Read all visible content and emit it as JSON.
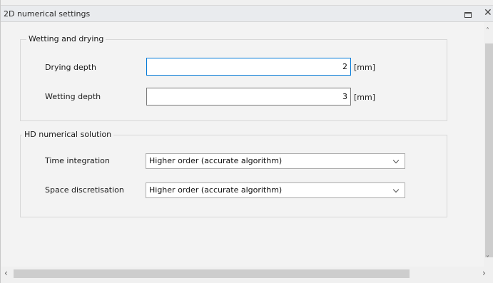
{
  "window": {
    "title": "2D numerical settings"
  },
  "wetting_drying": {
    "legend": "Wetting and drying",
    "drying_depth": {
      "label": "Drying depth",
      "value": "2",
      "unit": "[mm]"
    },
    "wetting_depth": {
      "label": "Wetting depth",
      "value": "3",
      "unit": "[mm]"
    }
  },
  "hd_solution": {
    "legend": "HD numerical solution",
    "time_integration": {
      "label": "Time integration",
      "selected": "Higher order (accurate algorithm)"
    },
    "space_discretisation": {
      "label": "Space discretisation",
      "selected": "Higher order (accurate algorithm)"
    }
  },
  "icons": {
    "restore": "restore-icon",
    "close": "close-icon",
    "scroll_up": "chevron-up-icon",
    "scroll_down": "chevron-down-icon",
    "scroll_left": "chevron-left-icon",
    "scroll_right": "chevron-right-icon",
    "dropdown": "chevron-down-icon"
  },
  "colors": {
    "focus_border": "#0078d7",
    "titlebar": "#e9ebee"
  }
}
